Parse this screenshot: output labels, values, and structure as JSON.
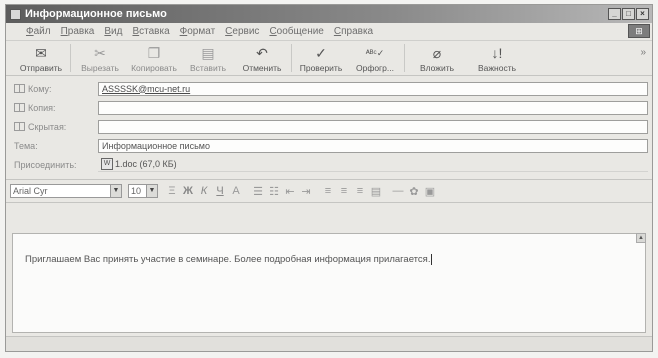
{
  "window": {
    "title": "Информационное письмо",
    "minimize": "_",
    "maximize": "□",
    "close": "×"
  },
  "menu": [
    "Файл",
    "Правка",
    "Вид",
    "Вставка",
    "Формат",
    "Сервис",
    "Сообщение",
    "Справка"
  ],
  "toolbar": {
    "send": "Отправить",
    "cut": "Вырезать",
    "copy": "Копировать",
    "paste": "Вставить",
    "undo": "Отменить",
    "check": "Проверить",
    "spelling": "Орфогр...",
    "attach": "Вложить",
    "priority": "Важность",
    "more": "»"
  },
  "headers": {
    "to_label": "Кому:",
    "to_value": "ASSSSK@mcu-net.ru",
    "cc_label": "Копия:",
    "cc_value": "",
    "bcc_label": "Скрытая:",
    "bcc_value": "",
    "subject_label": "Тема:",
    "subject_value": "Информационное письмо",
    "attach_label": "Присоединить:",
    "attach_file": "1.doc (67,0 КБ)"
  },
  "format": {
    "font": "Arial Cyr",
    "size": "10"
  },
  "body": {
    "text": "Приглашаем Вас принять участие в семинаре. Более подробная информация прилагается."
  },
  "icons": [
    "send-icon",
    "cut-icon",
    "copy-icon",
    "paste-icon",
    "undo-icon",
    "check-icon",
    "spelling-icon",
    "attach-icon",
    "priority-icon",
    "address-book-icon",
    "doc-icon",
    "bold-icon",
    "italic-icon",
    "underline-icon",
    "font-color-icon",
    "list-icon",
    "align-icon",
    "line-icon",
    "image-icon"
  ]
}
